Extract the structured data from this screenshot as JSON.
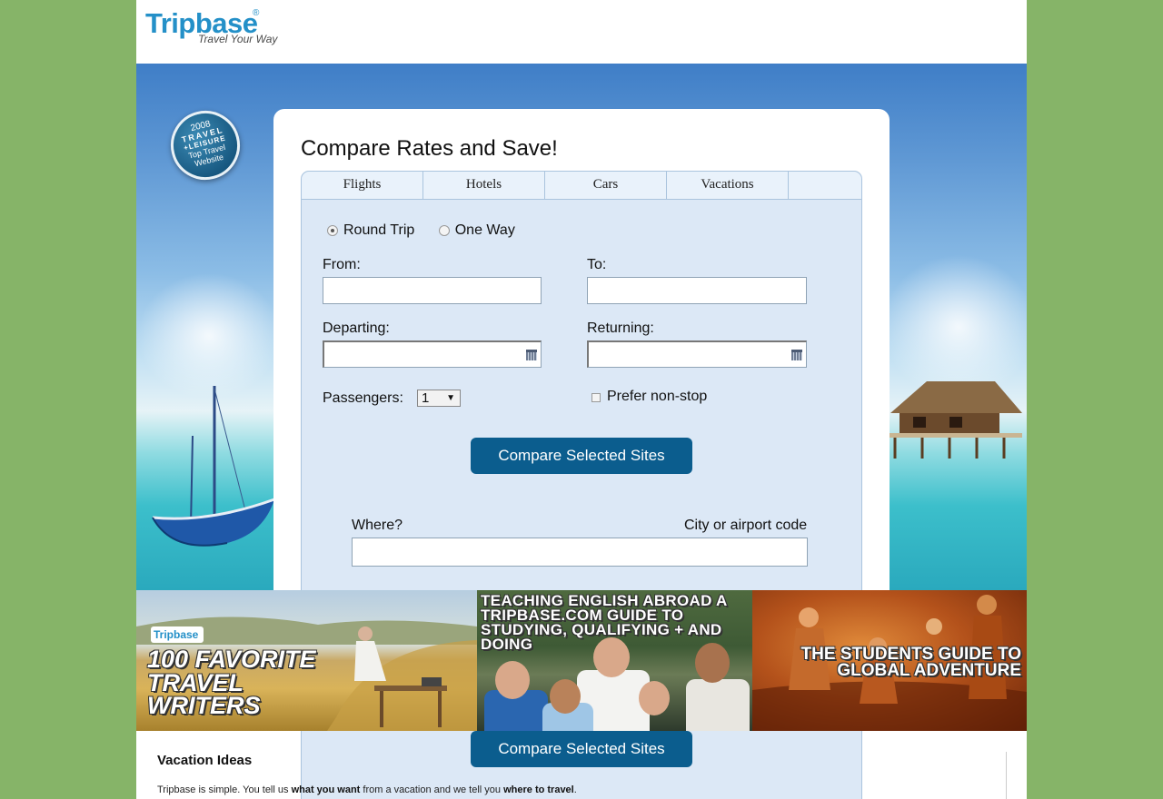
{
  "logo": {
    "name": "Tripbase",
    "registered": "®",
    "tagline": "Travel Your Way"
  },
  "award": {
    "year": "2008",
    "line1": "TRAVEL",
    "line2": "+LEISURE",
    "line3": "Top Travel",
    "line4": "Website"
  },
  "search": {
    "title": "Compare Rates and Save!",
    "tabs": [
      "Flights",
      "Hotels",
      "Cars",
      "Vacations"
    ],
    "trip_types": [
      "Round Trip",
      "One Way"
    ],
    "selected_trip_type": "Round Trip",
    "from_label": "From:",
    "from_value": "",
    "to_label": "To:",
    "to_value": "",
    "departing_label": "Departing:",
    "departing_value": "",
    "returning_label": "Returning:",
    "returning_value": "",
    "passengers_label": "Passengers:",
    "passengers_value": "1",
    "nonstop_label": "Prefer non-stop",
    "nonstop_checked": false,
    "compare_button": "Compare Selected Sites",
    "where_label": "Where?",
    "where_hint": "City or airport code",
    "where_value": "",
    "compare_button_2": "Compare Selected Sites"
  },
  "banners": {
    "b1_logo": "Tripbase",
    "b1_text": "100 Favorite Travel Writers",
    "b2_text": "Teaching English Abroad A Tripbase.com Guide To Studying, Qualifying + And Doing",
    "b3_text": "The Students Guide To Global Adventure"
  },
  "vacation": {
    "title": "Vacation Ideas",
    "text_1": "Tripbase is simple. You tell us ",
    "text_2": "what you want",
    "text_3": " from a vacation and we tell you ",
    "text_4": "where to travel",
    "text_5": "."
  },
  "colors": {
    "background": "#86b468",
    "brand": "#2490c8",
    "button": "#0b5d8e",
    "panel": "#dce8f6"
  }
}
